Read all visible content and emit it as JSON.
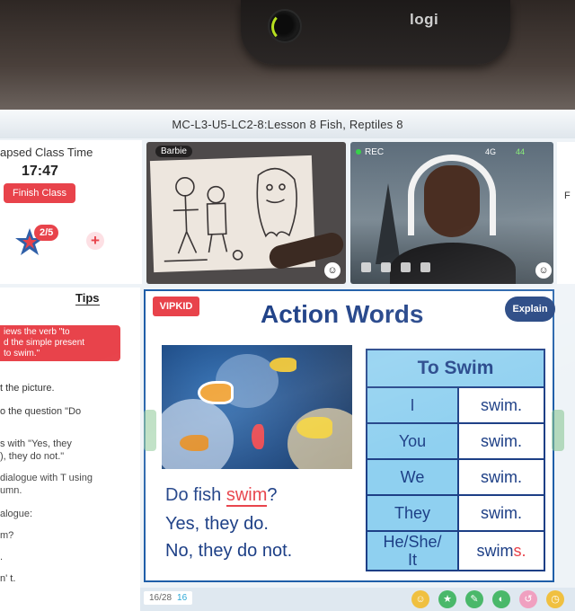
{
  "webcam": {
    "brand": "logi"
  },
  "window": {
    "title": "MC-L3-U5-LC2-8:Lesson 8 Fish, Reptiles 8"
  },
  "info_panel": {
    "elapsed_label": "apsed Class Time",
    "elapsed_time": "17:47",
    "finish_label": "Finish Class",
    "star_count": "2/5",
    "add_symbol": "+"
  },
  "student_video": {
    "name": "Barbie"
  },
  "teacher_video": {
    "rec_label": "REC",
    "signal": "4G",
    "wifi": "44"
  },
  "right_panel": {
    "text": "F"
  },
  "tips": {
    "title": "Tips",
    "highlight": "iews the verb \"to\nd the simple present\nto swim.\"",
    "lines": [
      "t the picture.",
      "o the question  \"Do",
      "s with  \"Yes, they",
      "), they do not.\"",
      "dialogue with T using",
      "umn.",
      "alogue:",
      "m?",
      ".",
      "n' t."
    ]
  },
  "slide": {
    "logo": "VIPKID",
    "title": "Action Words",
    "explain_label": "Explain",
    "question_prefix": "Do fish ",
    "question_verb": "swim",
    "question_suffix": "?",
    "answer_yes": "Yes, they do.",
    "answer_no": "No, they do not.",
    "table_header": "To Swim",
    "rows": [
      {
        "pronoun": "I",
        "verb": "swim.",
        "suffix": ""
      },
      {
        "pronoun": "You",
        "verb": "swim.",
        "suffix": ""
      },
      {
        "pronoun": "We",
        "verb": "swim.",
        "suffix": ""
      },
      {
        "pronoun": "They",
        "verb": "swim.",
        "suffix": ""
      },
      {
        "pronoun": "He/She/\nIt",
        "verb": "swim",
        "suffix": "s."
      }
    ]
  },
  "bottom_bar": {
    "page_total": "16/28",
    "page_current": "16"
  },
  "colors": {
    "accent_red": "#e8434b",
    "slide_blue": "#1d3f86",
    "table_cyan": "#8fd0f0"
  }
}
